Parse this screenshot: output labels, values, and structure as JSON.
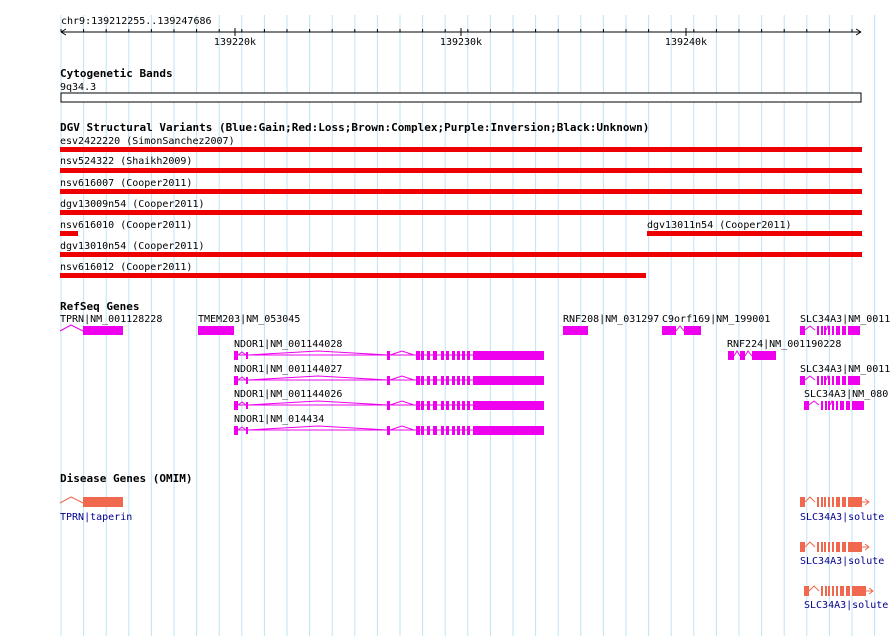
{
  "colors": {
    "grid": "#bfe3f7",
    "deletion": "#ee0000",
    "gene": "#ee00ee",
    "omim": "#f0694f",
    "omim_label": "#00008b",
    "text": "#000000"
  },
  "ruler": {
    "region": "chr9:139212255..139247686",
    "ticks": [
      "139220k",
      "139230k",
      "139240k"
    ]
  },
  "cytoband": {
    "title": "Cytogenetic Bands",
    "band": "9q34.3"
  },
  "dgv": {
    "title": "DGV Structural Variants (Blue:Gain;Red:Loss;Brown:Complex;Purple:Inversion;Black:Unknown)",
    "variants": [
      "esv2422220 (SimonSanchez2007)",
      "nsv524322 (Shaikh2009)",
      "nsv616007 (Cooper2011)",
      "dgv13009n54 (Cooper2011)",
      "nsv616010 (Cooper2011)",
      "dgv13011n54 (Cooper2011)",
      "dgv13010n54 (Cooper2011)",
      "nsv616012 (Cooper2011)"
    ]
  },
  "refseq": {
    "title": "RefSeq Genes",
    "genes": [
      "TPRN|NM_001128228",
      "TMEM203|NM_053045",
      "NDOR1|NM_001144028",
      "NDOR1|NM_001144027",
      "NDOR1|NM_001144026",
      "NDOR1|NM_014434",
      "RNF208|NM_031297",
      "C9orf169|NM_199001",
      "RNF224|NM_001190228",
      "SLC34A3|NM_0011",
      "SLC34A3|NM_0011",
      "SLC34A3|NM_080"
    ]
  },
  "omim": {
    "title": "Disease Genes (OMIM)",
    "genes": [
      "TPRN|taperin",
      "SLC34A3|solute",
      "SLC34A3|solute",
      "SLC34A3|solute"
    ]
  }
}
